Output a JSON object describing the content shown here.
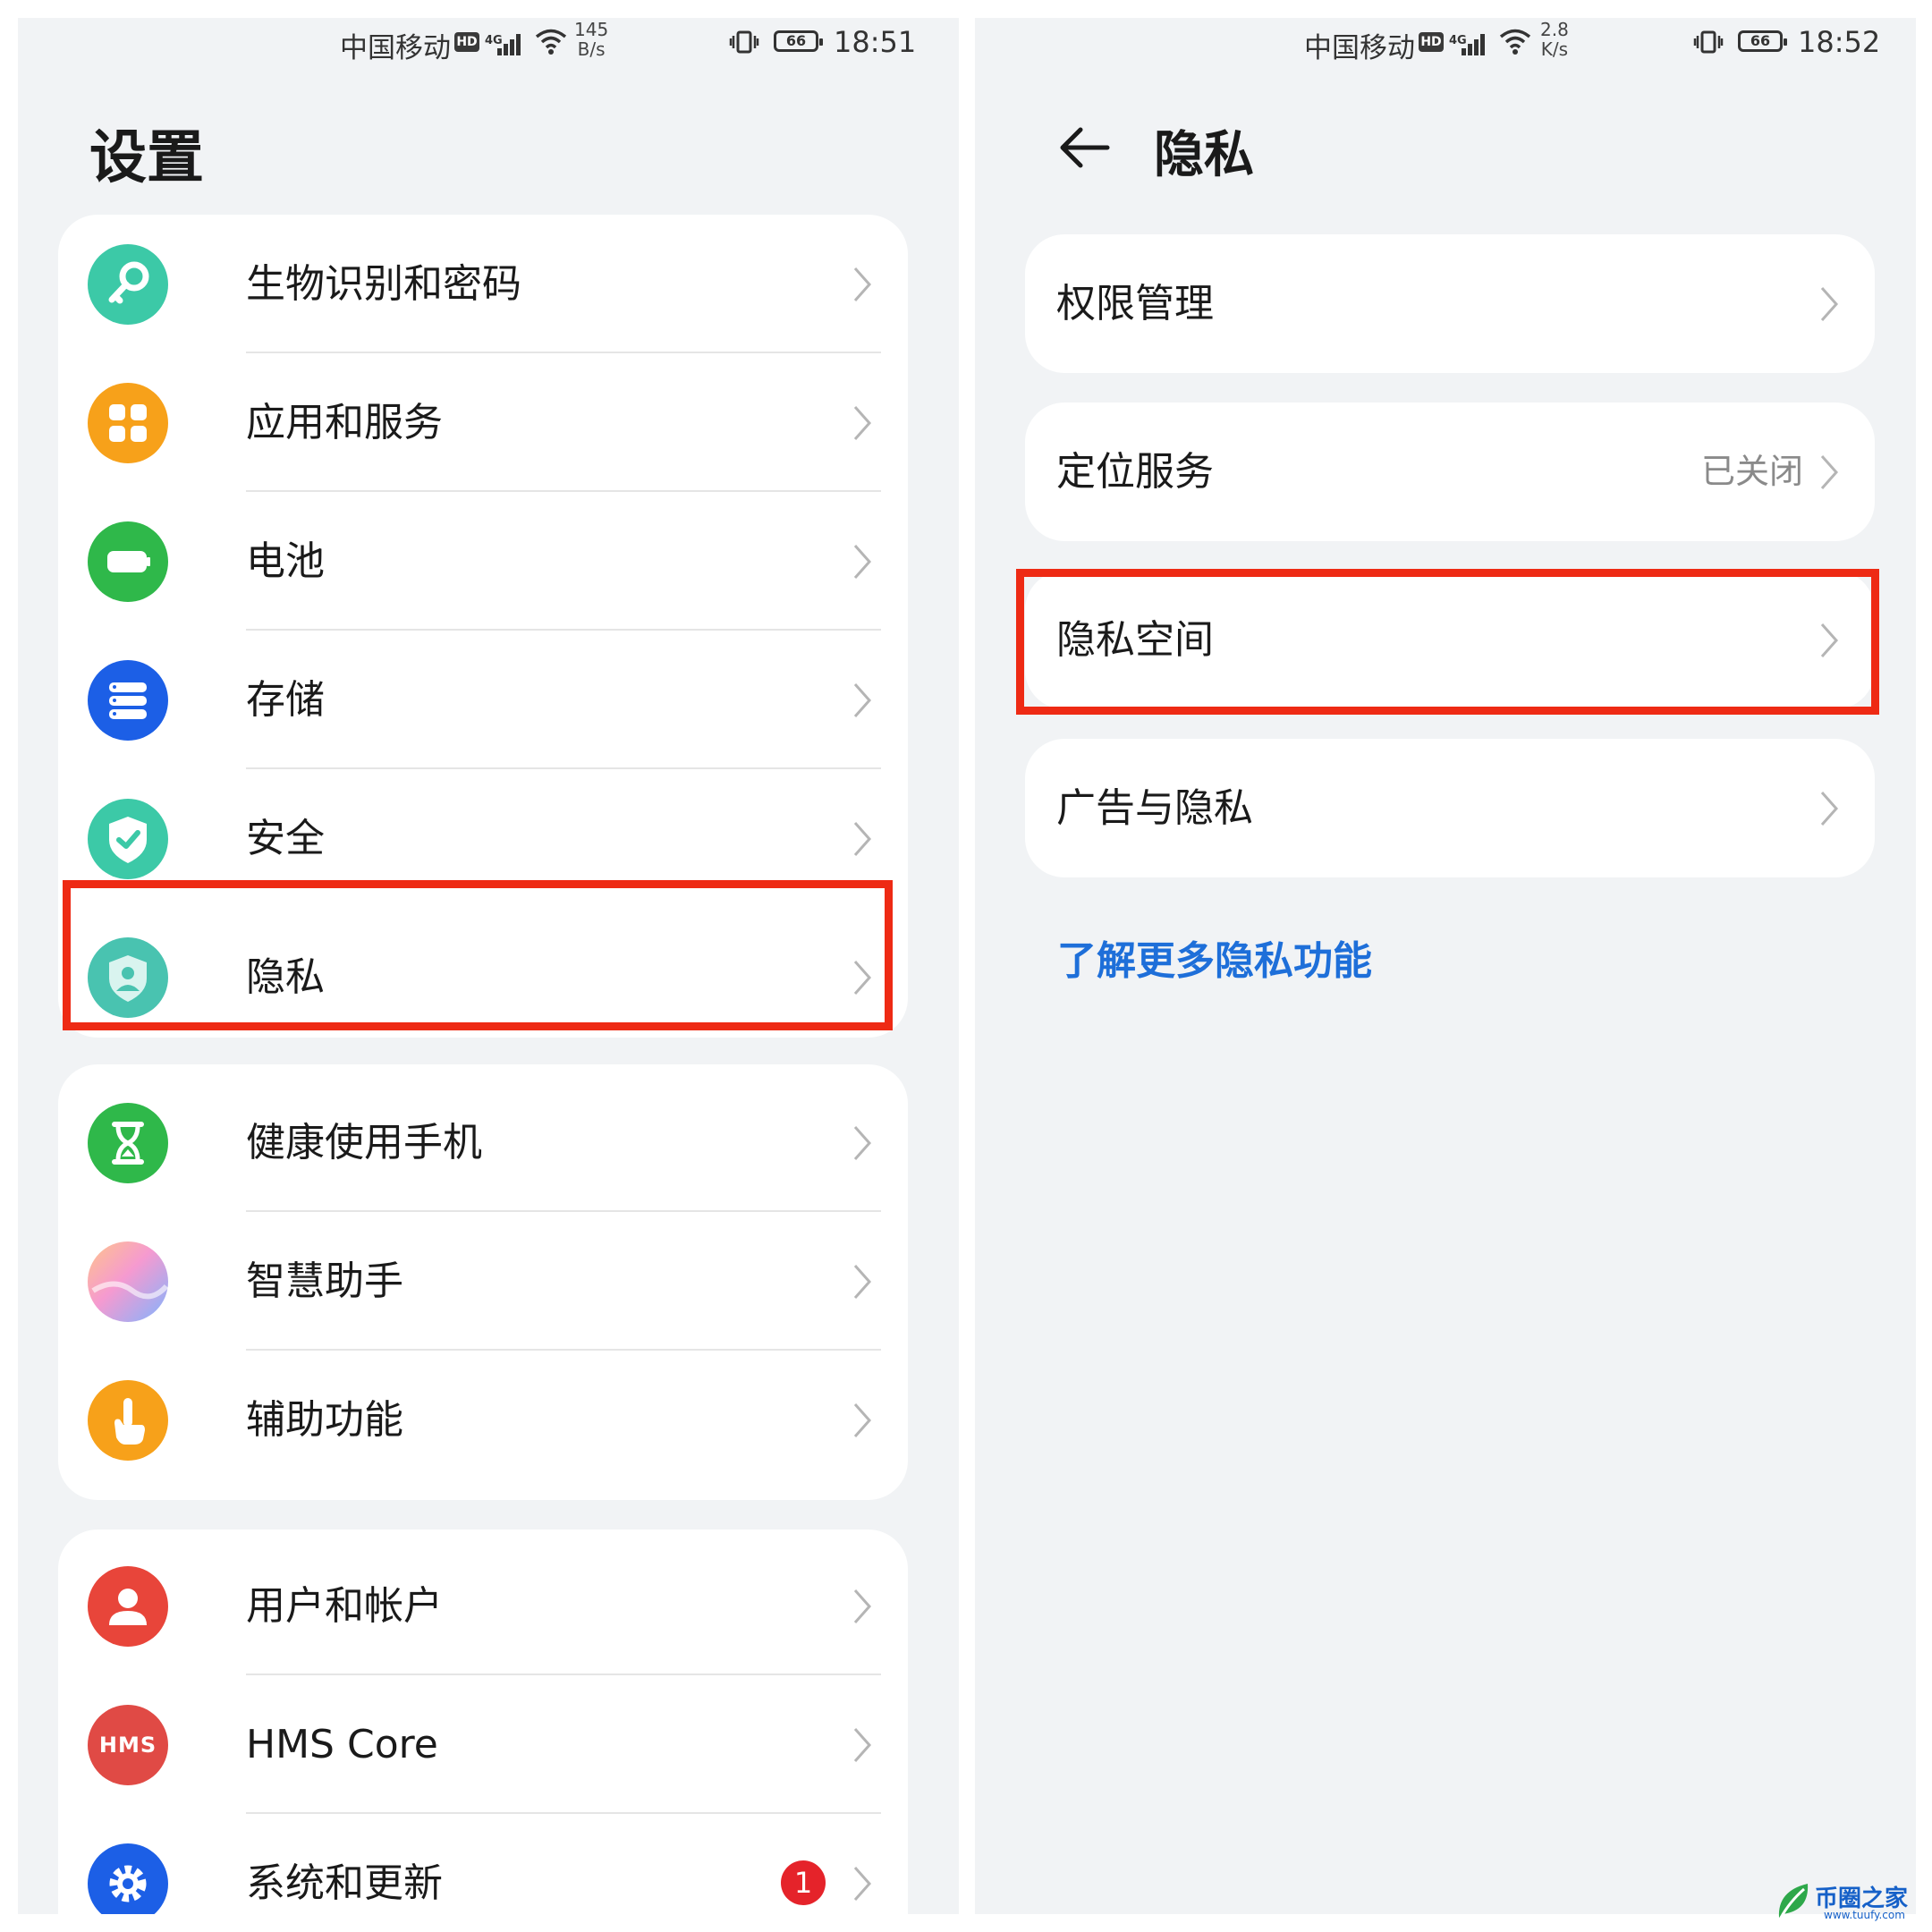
{
  "left": {
    "status": {
      "carrier": "中国移动",
      "hd": "HD",
      "net": "4G",
      "speed_top": "145",
      "speed_bottom": "B/s",
      "battery": "66",
      "time": "18:51"
    },
    "title": "设置",
    "group1": [
      {
        "label": "生物识别和密码",
        "icon": "key-icon",
        "color": "#3cc9a7"
      },
      {
        "label": "应用和服务",
        "icon": "apps-grid-icon",
        "color": "#f7a11a"
      },
      {
        "label": "电池",
        "icon": "battery-icon",
        "color": "#2fb84a"
      },
      {
        "label": "存储",
        "icon": "storage-icon",
        "color": "#1c5fe6"
      },
      {
        "label": "安全",
        "icon": "shield-check-icon",
        "color": "#3cc9a7"
      },
      {
        "label": "隐私",
        "icon": "privacy-shield-icon",
        "color": "#49c3b0"
      }
    ],
    "group2": [
      {
        "label": "健康使用手机",
        "icon": "hourglass-icon",
        "color": "#2fb84a"
      },
      {
        "label": "智慧助手",
        "icon": "assistant-orb-icon",
        "color": "#9ab3f5"
      },
      {
        "label": "辅助功能",
        "icon": "hand-touch-icon",
        "color": "#f7a11a"
      }
    ],
    "group3": [
      {
        "label": "用户和帐户",
        "icon": "user-icon",
        "color": "#e8453a"
      },
      {
        "label": "HMS Core",
        "icon": "hms-icon",
        "icon_text": "HMS",
        "color": "#e04a45"
      },
      {
        "label": "系统和更新",
        "icon": "settings-gear-icon",
        "color": "#1c5fe6",
        "badge": "1"
      }
    ]
  },
  "right": {
    "status": {
      "carrier": "中国移动",
      "hd": "HD",
      "net": "4G",
      "speed_top": "2.8",
      "speed_bottom": "K/s",
      "battery": "66",
      "time": "18:52"
    },
    "title": "隐私",
    "items": [
      {
        "label": "权限管理",
        "value": ""
      },
      {
        "label": "定位服务",
        "value": "已关闭"
      },
      {
        "label": "隐私空间",
        "value": ""
      },
      {
        "label": "广告与隐私",
        "value": ""
      }
    ],
    "link": "了解更多隐私功能"
  },
  "watermark": {
    "name": "币圈之家",
    "url": "www.tuufy.com"
  },
  "colors": {
    "highlight": "#ee2a14",
    "link": "#1e6fd9",
    "badge": "#e5232a"
  }
}
